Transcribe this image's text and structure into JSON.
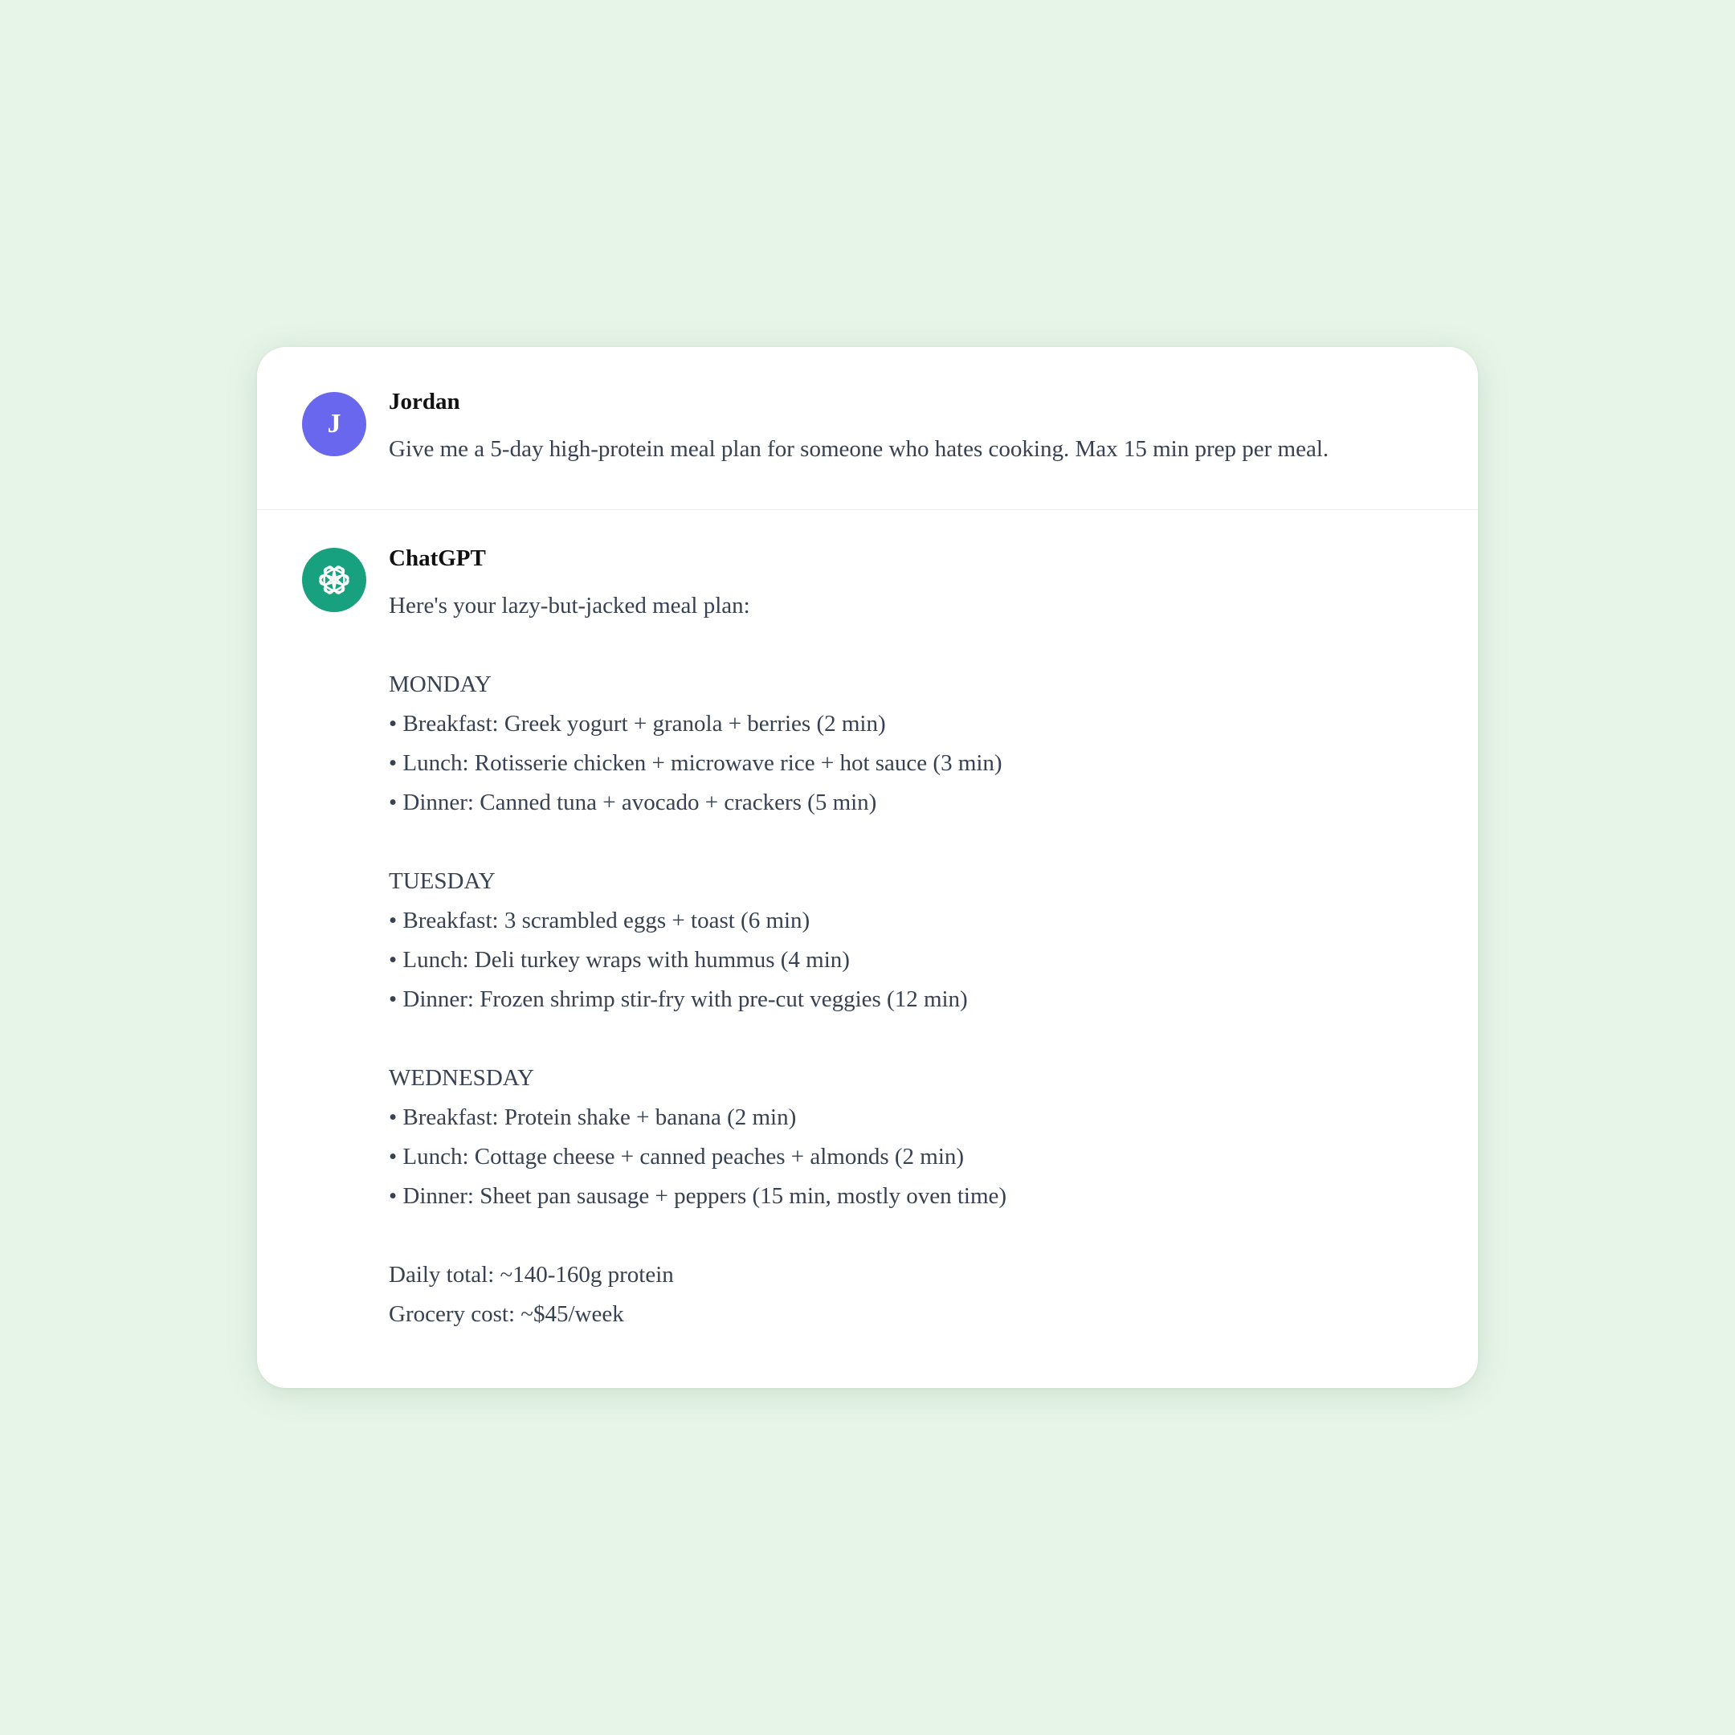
{
  "user": {
    "name": "Jordan",
    "avatar_initial": "J",
    "message": "Give me a 5-day high-protein meal plan for someone who hates cooking. Max 15 min prep per meal."
  },
  "assistant": {
    "name": "ChatGPT",
    "avatar_icon": "openai-logo-icon",
    "intro": "Here's your lazy-but-jacked meal plan:",
    "days": [
      {
        "heading": "MONDAY",
        "items": [
          "• Breakfast: Greek yogurt + granola + berries (2 min)",
          "• Lunch: Rotisserie chicken + microwave rice + hot sauce (3 min)",
          "• Dinner: Canned tuna + avocado + crackers (5 min)"
        ]
      },
      {
        "heading": "TUESDAY",
        "items": [
          "• Breakfast: 3 scrambled eggs + toast (6 min)",
          "• Lunch: Deli turkey wraps with hummus (4 min)",
          "• Dinner: Frozen shrimp stir-fry with pre-cut veggies (12 min)"
        ]
      },
      {
        "heading": "WEDNESDAY",
        "items": [
          "• Breakfast: Protein shake + banana (2 min)",
          "• Lunch: Cottage cheese + canned peaches + almonds (2 min)",
          "• Dinner: Sheet pan sausage + peppers (15 min, mostly oven time)"
        ]
      }
    ],
    "daily_total": "Daily total: ~140-160g protein",
    "grocery_cost": "Grocery cost: ~$45/week"
  },
  "colors": {
    "background": "#e7f5e8",
    "card": "#ffffff",
    "user_avatar": "#6867ee",
    "assistant_avatar": "#17a17f",
    "text": "#374151",
    "name_text": "#111111"
  }
}
